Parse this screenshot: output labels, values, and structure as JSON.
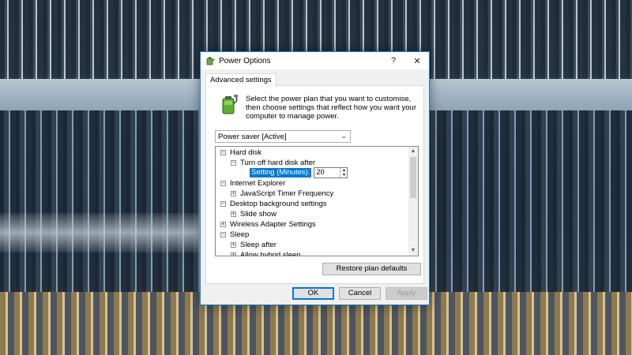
{
  "window": {
    "title": "Power Options",
    "help_glyph": "?",
    "close_glyph": "✕"
  },
  "tab": {
    "label": "Advanced settings"
  },
  "description": "Select the power plan that you want to customise, then choose settings that reflect how you want your computer to manage power.",
  "plan_select": {
    "selected": "Power saver [Active]"
  },
  "tree": {
    "hard_disk": "Hard disk",
    "turn_off_hard_disk": "Turn off hard disk after",
    "setting_label": "Setting (Minutes):",
    "setting_value": "20",
    "internet_explorer": "Internet Explorer",
    "js_timer": "JavaScript Timer Frequency",
    "desktop_bg": "Desktop background settings",
    "slide_show": "Slide show",
    "wireless": "Wireless Adapter Settings",
    "sleep": "Sleep",
    "sleep_after": "Sleep after",
    "allow_hybrid": "Allow hybrid sleep"
  },
  "buttons": {
    "restore": "Restore plan defaults",
    "ok": "OK",
    "cancel": "Cancel",
    "apply": "Apply"
  },
  "icons": {
    "app": "power-options-icon",
    "battery": "battery-plug-icon"
  },
  "colors": {
    "accent": "#0078d7",
    "window_border": "#1883d7"
  }
}
